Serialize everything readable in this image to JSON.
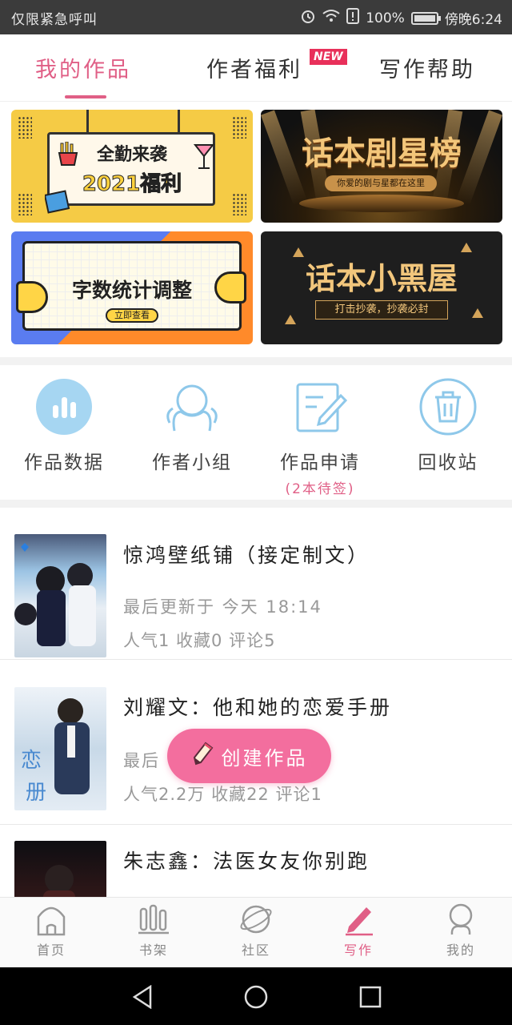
{
  "status_bar": {
    "left_text": "仅限紧急呼叫",
    "battery": "100%",
    "time": "傍晚6:24",
    "battery_level": 1.0
  },
  "tabs": {
    "items": [
      {
        "label": "我的作品",
        "active": true
      },
      {
        "label": "作者福利",
        "badge": "NEW"
      },
      {
        "label": "写作帮助"
      }
    ]
  },
  "banners": {
    "b1": {
      "line1": "全勤来袭",
      "line2": "2021福利"
    },
    "b2": {
      "title": "话本剧星榜",
      "subtitle": "你爱的剧与星都在这里"
    },
    "b3": {
      "title": "字数统计调整",
      "button": "立即查看"
    },
    "b4": {
      "title": "话本小黑屋",
      "tag": "打击抄袭，抄袭必封"
    }
  },
  "shortcuts": [
    {
      "label": "作品数据",
      "icon": "chart-icon"
    },
    {
      "label": "作者小组",
      "icon": "group-icon"
    },
    {
      "label": "作品申请",
      "icon": "edit-doc-icon",
      "sub": "(2本待签)"
    },
    {
      "label": "回收站",
      "icon": "trash-icon"
    }
  ],
  "works": [
    {
      "title": "惊鸿壁纸铺（接定制文）",
      "updated": "最后更新于 今天 18:14",
      "stats": "人气1 收藏0 评论5"
    },
    {
      "title": "刘耀文：他和她的恋爱手册",
      "updated": "最后",
      "stats": "人气2.2万 收藏22 评论1"
    },
    {
      "title": "朱志鑫：法医女友你别跑"
    }
  ],
  "fab": {
    "label": "创建作品",
    "icon": "pencil-icon"
  },
  "bottom_nav": [
    {
      "label": "首页",
      "icon": "home-icon"
    },
    {
      "label": "书架",
      "icon": "bookshelf-icon"
    },
    {
      "label": "社区",
      "icon": "planet-icon"
    },
    {
      "label": "写作",
      "icon": "pen-icon",
      "active": true
    },
    {
      "label": "我的",
      "icon": "profile-icon"
    }
  ],
  "colors": {
    "accent": "#e05f86",
    "fab": "#f36e9e",
    "badge": "#e8305a",
    "icon_blue": "#8ec8ea"
  }
}
